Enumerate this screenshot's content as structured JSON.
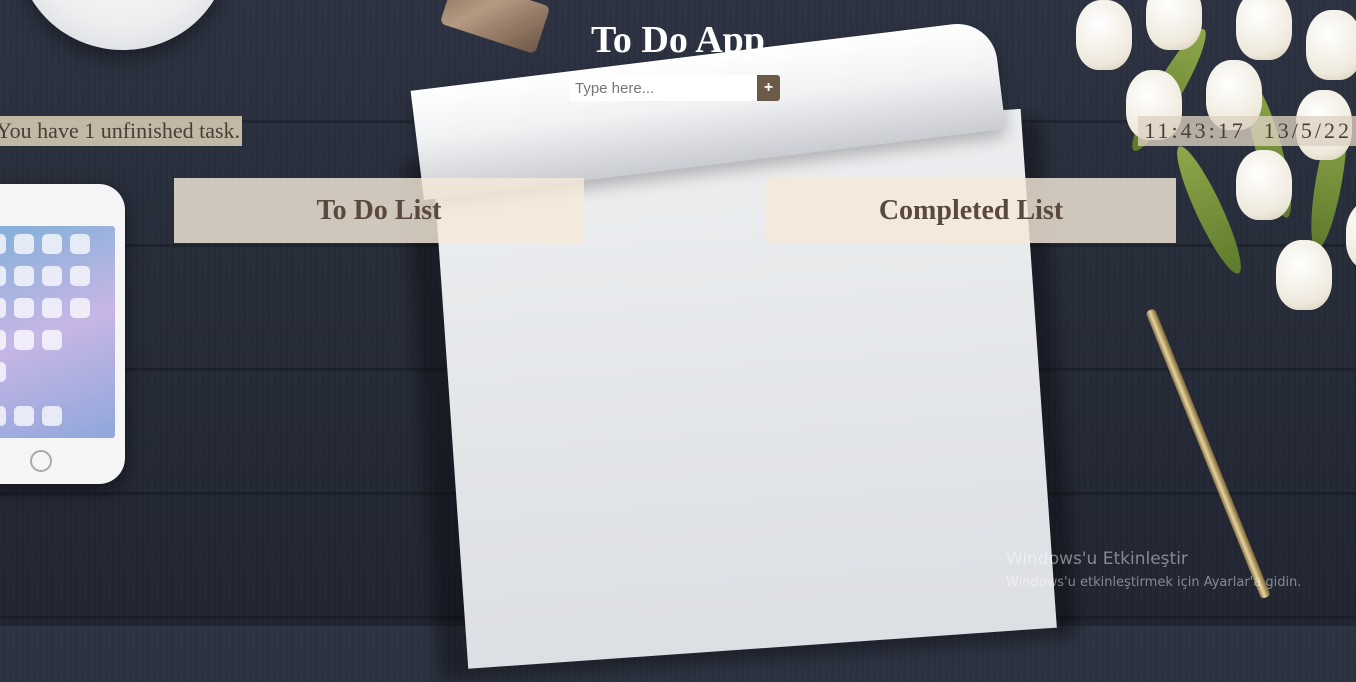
{
  "app": {
    "title": "To Do App"
  },
  "input": {
    "placeholder": "Type here...",
    "value": "",
    "add_label": "+"
  },
  "status": {
    "unfinished_text": "You have 1 unfinished task."
  },
  "clock": {
    "time": "11:43:17",
    "date": "13/5/22"
  },
  "lists": {
    "todo_title": "To Do List",
    "completed_title": "Completed List"
  },
  "watermark": {
    "line1": "Windows'u Etkinleştir",
    "line2": "Windows'u etkinleştirmek için Ayarlar'a gidin."
  }
}
